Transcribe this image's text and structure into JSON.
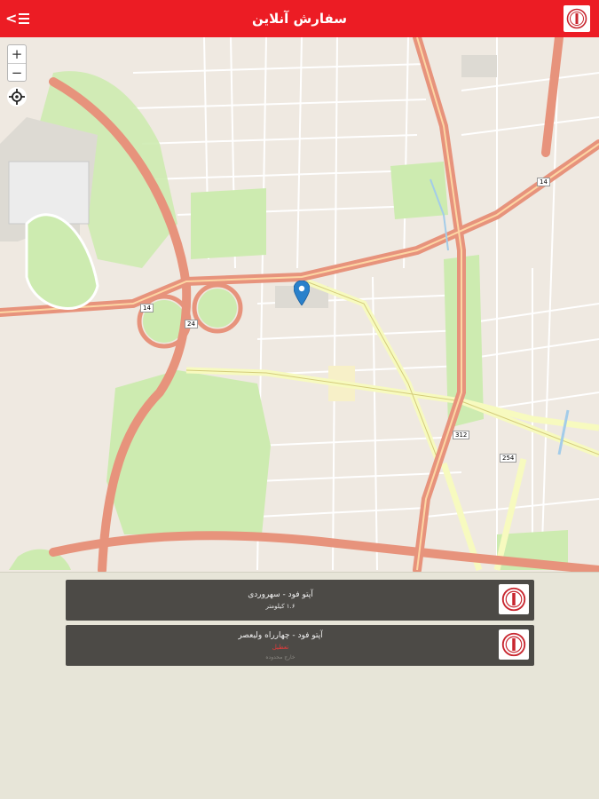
{
  "header": {
    "title": "سفارش آنلاین",
    "back_glyph": "<"
  },
  "map": {
    "zoom_in": "+",
    "zoom_out": "−",
    "highway_labels": [
      "14",
      "24",
      "312",
      "254"
    ]
  },
  "stores": [
    {
      "name": "آپتو فود - سهروردی",
      "distance": "۱.۶ کیلومتر"
    },
    {
      "name": "آپتو فود - چهارراه ولیعصر",
      "status": "تعطیل",
      "note": "خارج محدوده"
    }
  ],
  "colors": {
    "brand": "#ec1c24",
    "card": "#4c4a46",
    "panel": "#e7e5d8",
    "map_land": "#efe9e1",
    "map_park": "#cdebb0",
    "map_highway": "#e7937c",
    "map_road_major": "#f7fabf"
  }
}
